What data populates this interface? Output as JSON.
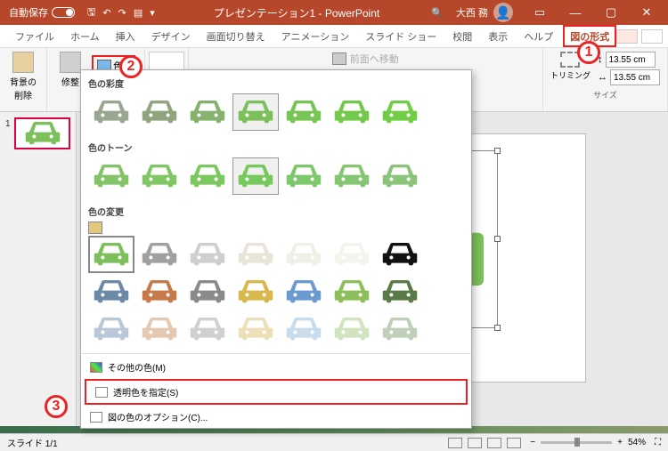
{
  "titlebar": {
    "autosave_label": "自動保存",
    "toggle_state": "オフ",
    "title": "プレゼンテーション1 - PowerPoint",
    "user_name": "大西 務"
  },
  "tabs": {
    "items": [
      "ファイル",
      "ホーム",
      "挿入",
      "デザイン",
      "画面切り替え",
      "アニメーション",
      "スライド ショー",
      "校閲",
      "表示",
      "ヘルプ"
    ],
    "format_tab": "図の形式"
  },
  "ribbon": {
    "remove_bg": "背景の\n削除",
    "corrections": "修整",
    "color_label": "色",
    "bring_forward": "前面へ移動",
    "trimming": "トリミング",
    "height": "13.55 cm",
    "width": "13.55 cm",
    "size_label": "サイズ"
  },
  "gallery": {
    "saturation_title": "色の彩度",
    "saturation_colors": [
      "#9aa690",
      "#8fa47f",
      "#86b26d",
      "#7cc05b",
      "#78c454",
      "#74c94d",
      "#70cd46"
    ],
    "tone_title": "色のトーン",
    "tone_colors": [
      "#84c468",
      "#80c664",
      "#7cc860",
      "#78c95c",
      "#7cc86a",
      "#84c672",
      "#8cc47a"
    ],
    "recolor_title": "色の変更",
    "recolor_rows": [
      [
        "#7cc05b",
        "#a0a0a0",
        "#cfcfcf",
        "#e8e4d8",
        "#f0f0e8",
        "#f4f4ee",
        "#111111"
      ],
      [
        "#6a8aa8",
        "#c67a4a",
        "#8a8a8a",
        "#d8b84a",
        "#6a9ad0",
        "#8cbf5a",
        "#5a7a48"
      ],
      [
        "#b8c8d8",
        "#e4c8b0",
        "#d0d0d0",
        "#ece0b8",
        "#c8dceC",
        "#d0e4c0",
        "#c0d0b8"
      ]
    ],
    "more_colors": "その他の色(M)",
    "set_transparent": "透明色を指定(S)",
    "picture_color_options": "図の色のオプション(C)..."
  },
  "thumbs": {
    "slide_num": "1"
  },
  "statusbar": {
    "slide_info": "スライド 1/1",
    "lang": "",
    "zoom": "54%"
  },
  "annotations": {
    "a1": "1",
    "a2": "2",
    "a3": "3"
  }
}
